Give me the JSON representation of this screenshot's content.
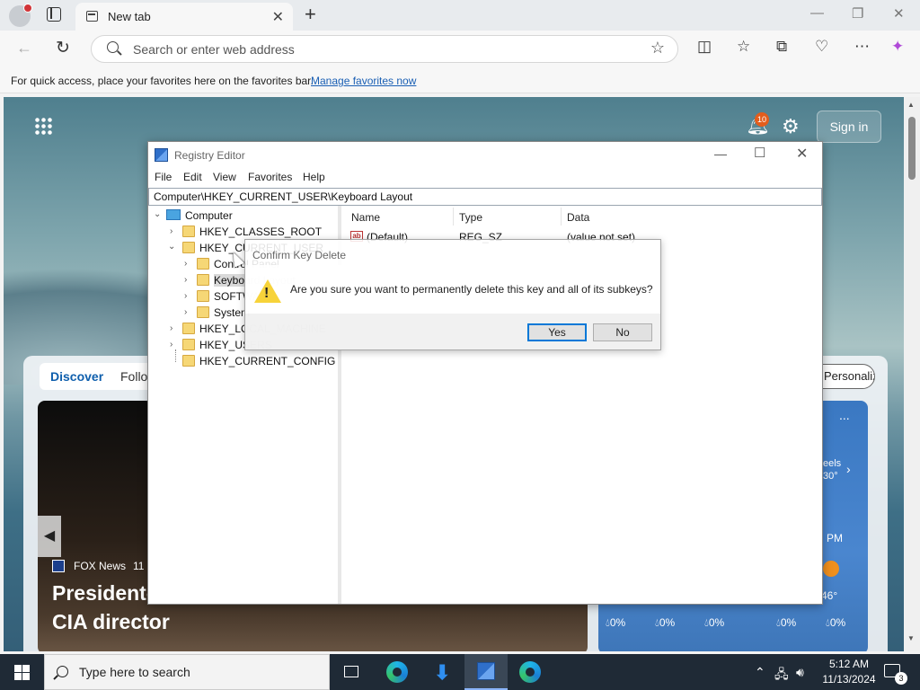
{
  "browser": {
    "tab_title": "New tab",
    "address_placeholder": "Search or enter web address",
    "favorites_bar_text": "For quick access, place your favorites here on the favorites bar.",
    "favorites_bar_link": "Manage favorites now"
  },
  "ntp": {
    "notification_count": "10",
    "sign_in_label": "Sign in",
    "feed_tabs": [
      "Discover",
      "Following"
    ],
    "personalize_label": "Personalize",
    "news": {
      "source": "FOX News",
      "time": "11",
      "headline_line1": "President-",
      "headline_line2": "CIA director"
    },
    "weather": {
      "more": "...",
      "feels_label": "eels",
      "feels_value": "30°",
      "next": "›",
      "hour": "PM",
      "temp": "46°",
      "precip": [
        "0%",
        "0%",
        "0%",
        "0%",
        "0%"
      ]
    }
  },
  "regedit": {
    "title": "Registry Editor",
    "menu": [
      "File",
      "Edit",
      "View",
      "Favorites",
      "Help"
    ],
    "path": "Computer\\HKEY_CURRENT_USER\\Keyboard Layout",
    "tree": {
      "root": "Computer",
      "classes_root": "HKEY_CLASSES_ROOT",
      "current_user": "HKEY_CURRENT_USER",
      "control_panel": "Control Panel",
      "keyboard_layout": "Keyboard Layout",
      "software": "SOFTWARE",
      "system": "System",
      "local_machine": "HKEY_LOCAL_MACHINE",
      "users": "HKEY_USERS",
      "current_config": "HKEY_CURRENT_CONFIG"
    },
    "columns": [
      "Name",
      "Type",
      "Data"
    ],
    "rows": [
      {
        "name": "(Default)",
        "type": "REG_SZ",
        "data": "(value not set)"
      }
    ]
  },
  "dialog": {
    "title": "Confirm Key Delete",
    "message": "Are you sure you want to permanently delete this key and all of its subkeys?",
    "yes_label": "Yes",
    "no_label": "No"
  },
  "taskbar": {
    "search_placeholder": "Type here to search",
    "time": "5:12 AM",
    "date": "11/13/2024",
    "notification_count": "3"
  }
}
